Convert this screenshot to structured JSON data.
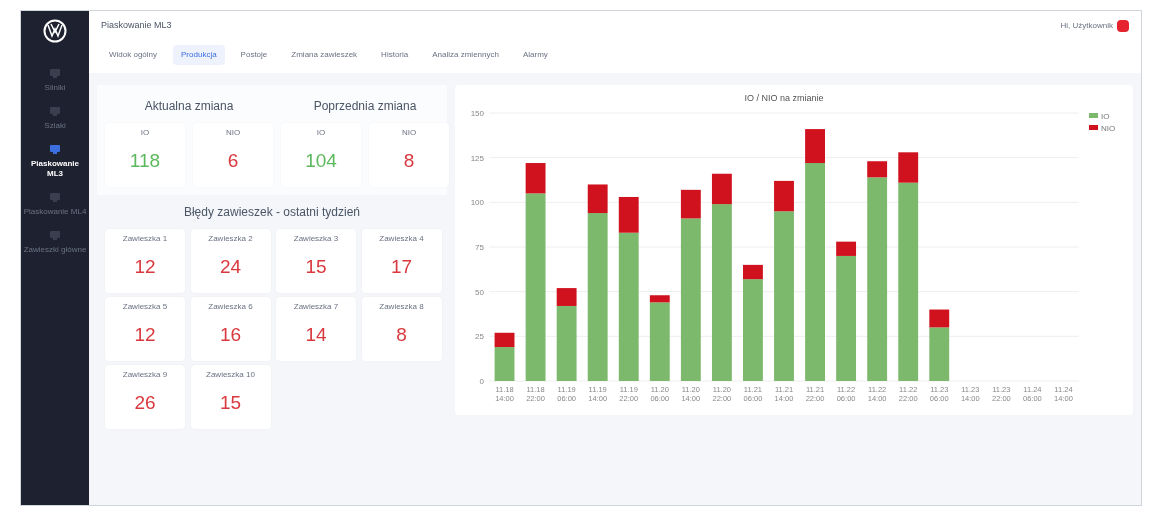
{
  "sidebar": {
    "items": [
      {
        "label": "Silniki",
        "selected": false
      },
      {
        "label": "Szlaki",
        "selected": false
      },
      {
        "label": "Piaskowanie ML3",
        "selected": true
      },
      {
        "label": "Piaskowanie ML4",
        "selected": false
      },
      {
        "label": "Zawieszki główne",
        "selected": false
      }
    ]
  },
  "header": {
    "title": "Piaskowanie ML3",
    "user": "Hi, Użytkownik"
  },
  "tabs": [
    {
      "label": "Widok ogólny",
      "selected": false
    },
    {
      "label": "Produkcja",
      "selected": true
    },
    {
      "label": "Postoje",
      "selected": false
    },
    {
      "label": "Zmiana zawieszek",
      "selected": false
    },
    {
      "label": "Historia",
      "selected": false
    },
    {
      "label": "Analiza zmiennych",
      "selected": false
    },
    {
      "label": "Alarmy",
      "selected": false
    }
  ],
  "shifts": [
    {
      "title": "Aktualna zmiana",
      "tiles": [
        {
          "label": "IO",
          "value": "118",
          "kind": "good"
        },
        {
          "label": "NIO",
          "value": "6",
          "kind": "bad"
        }
      ]
    },
    {
      "title": "Poprzednia zmiana",
      "tiles": [
        {
          "label": "IO",
          "value": "104",
          "kind": "good"
        },
        {
          "label": "NIO",
          "value": "8",
          "kind": "bad"
        }
      ]
    }
  ],
  "errors": {
    "title": "Błędy zawieszek - ostatni tydzień",
    "tiles": [
      {
        "label": "Zawieszka 1",
        "value": "12"
      },
      {
        "label": "Zawieszka 2",
        "value": "24"
      },
      {
        "label": "Zawieszka 3",
        "value": "15"
      },
      {
        "label": "Zawieszka 4",
        "value": "17"
      },
      {
        "label": "Zawieszka 5",
        "value": "12"
      },
      {
        "label": "Zawieszka 6",
        "value": "16"
      },
      {
        "label": "Zawieszka 7",
        "value": "14"
      },
      {
        "label": "Zawieszka 8",
        "value": "8"
      },
      {
        "label": "Zawieszka 9",
        "value": "26"
      },
      {
        "label": "Zawieszka 10",
        "value": "15"
      }
    ]
  },
  "chart_data": {
    "type": "bar",
    "title": "IO / NIO na zmianie",
    "stacked": true,
    "grid": true,
    "legend": true,
    "categories": [
      "11.18 14:00",
      "11.18 22:00",
      "11.19 06:00",
      "11.19 14:00",
      "11.19 22:00",
      "11.20 06:00",
      "11.20 14:00",
      "11.20 22:00",
      "11.21 06:00",
      "11.21 14:00",
      "11.21 22:00",
      "11.22 06:00",
      "11.22 14:00",
      "11.22 22:00",
      "11.23 06:00",
      "11.23 14:00",
      "11.23 22:00",
      "11.24 06:00",
      "11.24 14:00"
    ],
    "series": [
      {
        "name": "IO",
        "color": "#7cb96c",
        "values": [
          19,
          105,
          42,
          94,
          83,
          44,
          91,
          99,
          57,
          95,
          122,
          70,
          114,
          111,
          30,
          null,
          null,
          null,
          null
        ]
      },
      {
        "name": "NIO",
        "color": "#d0121f",
        "values": [
          8,
          17,
          10,
          16,
          20,
          4,
          16,
          17,
          8,
          17,
          19,
          8,
          9,
          17,
          10,
          null,
          null,
          null,
          null
        ]
      }
    ],
    "ylim": [
      0,
      150
    ],
    "yticks": [
      0,
      25,
      50,
      75,
      100,
      125,
      150
    ]
  }
}
